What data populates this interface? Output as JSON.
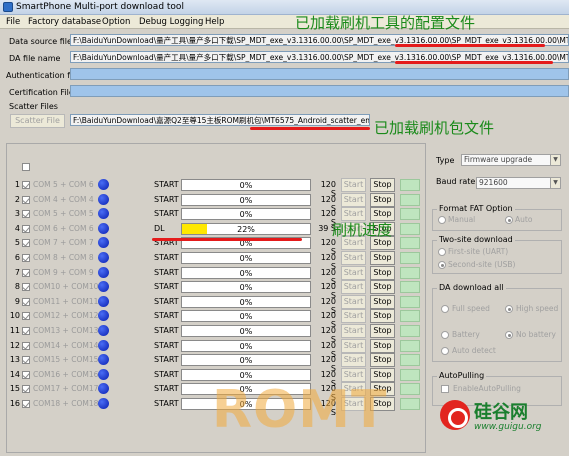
{
  "window": {
    "title": "SmartPhone Multi-port download tool"
  },
  "menu": [
    "File",
    "Factory database",
    "Option",
    "Debug Logging",
    "Help"
  ],
  "fields": {
    "data_source": {
      "label": "Data source file",
      "value": "F:\\BaiduYunDownload\\量产工具\\量产多口下载\\SP_MDT_exe_v3.1316.00.00\\SP_MDT_exe_v3.1316.00.00\\SP_MDT_exe_v3.1316.00.00\\MTK_DAT"
    },
    "da_file": {
      "label": "DA file name",
      "value": "F:\\BaiduYunDownload\\量产工具\\量产多口下载\\SP_MDT_exe_v3.1316.00.00\\SP_MDT_exe_v3.1316.00.00\\SP_MDT_exe_v3.1316.00.00\\MTK_AllIn"
    },
    "auth_file": {
      "label": "Authentication file",
      "value": ""
    },
    "cert_file": {
      "label": "Certification File",
      "value": ""
    },
    "scatter": {
      "group_label": "Scatter Files",
      "button": "Scatter File",
      "value": "F:\\BaiduYunDownload\\嘉源Q2至尊15主板ROM刷机包\\MT6575_Android_scatter_emmc.txt"
    }
  },
  "annotations": {
    "config_loaded": "已加载刷机工具的配置文件",
    "package_loaded": "已加载刷机包文件",
    "progress": "刷机进度"
  },
  "ports": [
    {
      "num": "1",
      "com": "COM 5 + COM 6",
      "status": "START",
      "progress": 0,
      "pct": "0%",
      "time": "120 S"
    },
    {
      "num": "2",
      "com": "COM 4 + COM 4",
      "status": "START",
      "progress": 0,
      "pct": "0%",
      "time": "120 S"
    },
    {
      "num": "3",
      "com": "COM 5 + COM 5",
      "status": "START",
      "progress": 0,
      "pct": "0%",
      "time": "120 S"
    },
    {
      "num": "4",
      "com": "COM 6 + COM 6",
      "status": "DL",
      "progress": 22,
      "pct": "22%",
      "time": "39 S"
    },
    {
      "num": "5",
      "com": "COM 7 + COM 7",
      "status": "START",
      "progress": 0,
      "pct": "0%",
      "time": "120 S"
    },
    {
      "num": "6",
      "com": "COM 8 + COM 8",
      "status": "START",
      "progress": 0,
      "pct": "0%",
      "time": "120 S"
    },
    {
      "num": "7",
      "com": "COM 9 + COM 9",
      "status": "START",
      "progress": 0,
      "pct": "0%",
      "time": "120 S"
    },
    {
      "num": "8",
      "com": "COM10 + COM10",
      "status": "START",
      "progress": 0,
      "pct": "0%",
      "time": "120 S"
    },
    {
      "num": "9",
      "com": "COM11 + COM11",
      "status": "START",
      "progress": 0,
      "pct": "0%",
      "time": "120 S"
    },
    {
      "num": "10",
      "com": "COM12 + COM12",
      "status": "START",
      "progress": 0,
      "pct": "0%",
      "time": "120 S"
    },
    {
      "num": "11",
      "com": "COM13 + COM13",
      "status": "START",
      "progress": 0,
      "pct": "0%",
      "time": "120 S"
    },
    {
      "num": "12",
      "com": "COM14 + COM14",
      "status": "START",
      "progress": 0,
      "pct": "0%",
      "time": "120 S"
    },
    {
      "num": "13",
      "com": "COM15 + COM15",
      "status": "START",
      "progress": 0,
      "pct": "0%",
      "time": "120 S"
    },
    {
      "num": "14",
      "com": "COM16 + COM16",
      "status": "START",
      "progress": 0,
      "pct": "0%",
      "time": "120 S"
    },
    {
      "num": "15",
      "com": "COM17 + COM17",
      "status": "START",
      "progress": 0,
      "pct": "0%",
      "time": "120 S"
    },
    {
      "num": "16",
      "com": "COM18 + COM18",
      "status": "START",
      "progress": 0,
      "pct": "0%",
      "time": "120 S"
    }
  ],
  "row_buttons": {
    "start": "Start",
    "stop": "Stop"
  },
  "right_panel": {
    "type_label": "Type",
    "type_value": "Firmware upgrade",
    "baud_label": "Baud rate",
    "baud_value": "921600",
    "format": {
      "title": "Format FAT Option",
      "manual": "Manual",
      "auto": "Auto"
    },
    "two_site": {
      "title": "Two-site download",
      "first": "First-site (UART)",
      "second": "Second-site (USB)"
    },
    "da_all": {
      "title": "DA download all",
      "full": "Full speed",
      "high": "High speed",
      "battery": "Battery",
      "no_battery": "No battery",
      "auto_detect": "Auto detect"
    },
    "autopulling": {
      "title": "AutoPulling",
      "enable": "EnableAutoPulling"
    }
  },
  "watermark": {
    "text": "ROMT",
    "site_cn": "硅谷网",
    "site_url": "www.guigu.org"
  },
  "colors": {
    "annotation": "#1a8a1a",
    "underline": "#e41b1b",
    "progress_fill": "#ffe800",
    "port_dot": "#0a1fb0"
  }
}
